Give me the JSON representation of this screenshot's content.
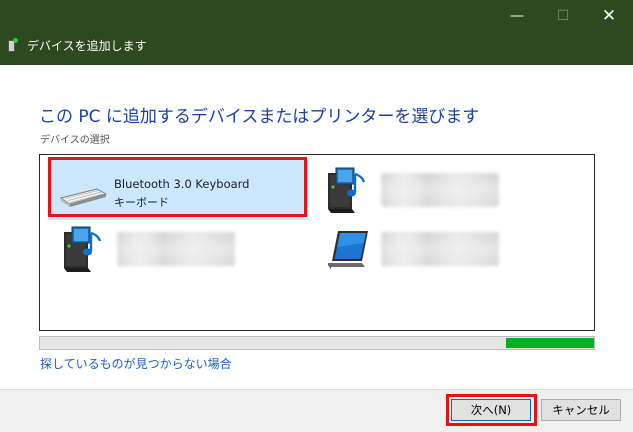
{
  "window": {
    "title": "デバイスを追加します",
    "controls": {
      "minimize": "—",
      "maximize": "☐",
      "close": "✕"
    }
  },
  "page": {
    "heading": "この PC に追加するデバイスまたはプリンターを選びます",
    "section_label": "デバイスの選択"
  },
  "devices": [
    {
      "name": "Bluetooth 3.0 Keyboard",
      "type": "キーボード",
      "icon": "keyboard-icon",
      "selected": true
    },
    {
      "name": "",
      "type": "",
      "icon": "media-device-icon",
      "selected": false,
      "obscured": true
    },
    {
      "name": "",
      "type": "",
      "icon": "media-device-icon",
      "selected": false,
      "obscured": true
    },
    {
      "name": "",
      "type": "",
      "icon": "tablet-icon",
      "selected": false,
      "obscured": true
    }
  ],
  "search_progress": {
    "indeterminate": true
  },
  "help_link": "探しているものが見つからない場合",
  "buttons": {
    "next": "次へ(N)",
    "cancel": "キャンセル"
  },
  "colors": {
    "titlebar": "#2d4a1e",
    "heading": "#1a3fa6",
    "selection": "#cce8ff",
    "annotation": "#e41414",
    "progress": "#06b025",
    "link": "#1d5fc3"
  }
}
